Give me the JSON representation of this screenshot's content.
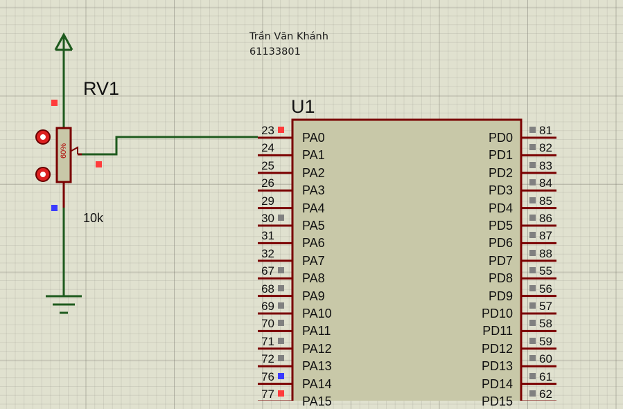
{
  "author": {
    "name": "Trần Văn Khánh",
    "student_id": "61133801"
  },
  "potentiometer": {
    "ref": "RV1",
    "value": "10k",
    "percent": "60%"
  },
  "chip": {
    "ref": "U1",
    "left_pins": [
      {
        "num": "23",
        "name": "PA0",
        "state": "high"
      },
      {
        "num": "24",
        "name": "PA1",
        "state": "none"
      },
      {
        "num": "25",
        "name": "PA2",
        "state": "none"
      },
      {
        "num": "26",
        "name": "PA3",
        "state": "none"
      },
      {
        "num": "29",
        "name": "PA4",
        "state": "none"
      },
      {
        "num": "30",
        "name": "PA5",
        "state": "unknown"
      },
      {
        "num": "31",
        "name": "PA6",
        "state": "none"
      },
      {
        "num": "32",
        "name": "PA7",
        "state": "none"
      },
      {
        "num": "67",
        "name": "PA8",
        "state": "unknown"
      },
      {
        "num": "68",
        "name": "PA9",
        "state": "unknown"
      },
      {
        "num": "69",
        "name": "PA10",
        "state": "unknown"
      },
      {
        "num": "70",
        "name": "PA11",
        "state": "unknown"
      },
      {
        "num": "71",
        "name": "PA12",
        "state": "unknown"
      },
      {
        "num": "72",
        "name": "PA13",
        "state": "unknown"
      },
      {
        "num": "76",
        "name": "PA14",
        "state": "low"
      },
      {
        "num": "77",
        "name": "PA15",
        "state": "high"
      }
    ],
    "right_pins": [
      {
        "num": "81",
        "name": "PD0"
      },
      {
        "num": "82",
        "name": "PD1"
      },
      {
        "num": "83",
        "name": "PD2"
      },
      {
        "num": "84",
        "name": "PD3"
      },
      {
        "num": "85",
        "name": "PD4"
      },
      {
        "num": "86",
        "name": "PD5"
      },
      {
        "num": "87",
        "name": "PD6"
      },
      {
        "num": "88",
        "name": "PD7"
      },
      {
        "num": "55",
        "name": "PD8"
      },
      {
        "num": "56",
        "name": "PD9"
      },
      {
        "num": "57",
        "name": "PD10"
      },
      {
        "num": "58",
        "name": "PD11"
      },
      {
        "num": "59",
        "name": "PD12"
      },
      {
        "num": "60",
        "name": "PD13"
      },
      {
        "num": "61",
        "name": "PD14"
      },
      {
        "num": "62",
        "name": "PD15"
      }
    ]
  },
  "colors": {
    "wire": "#1e5a1e",
    "pin": "#7a0000",
    "chip_fill": "#c8c8a8",
    "state_high": "#ff3b3b",
    "state_low": "#3a3aff",
    "state_unknown": "#808080"
  },
  "icons": [
    "power-arrow-icon",
    "ground-icon",
    "probe-plus-icon",
    "probe-minus-icon"
  ]
}
